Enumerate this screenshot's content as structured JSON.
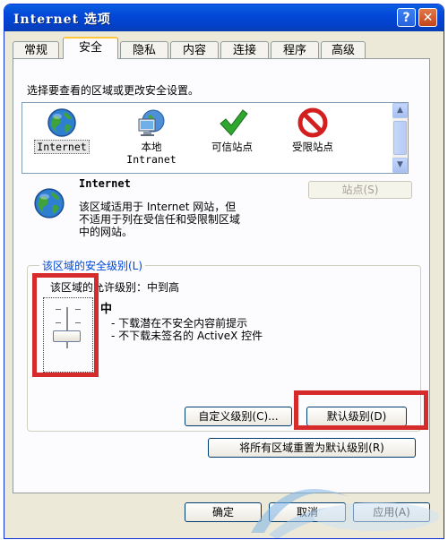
{
  "window": {
    "title": "Internet 选项",
    "help_button": "?",
    "close_button": "✕"
  },
  "tabs": [
    {
      "label": "常规",
      "active": false
    },
    {
      "label": "安全",
      "active": true
    },
    {
      "label": "隐私",
      "active": false
    },
    {
      "label": "内容",
      "active": false
    },
    {
      "label": "连接",
      "active": false
    },
    {
      "label": "程序",
      "active": false
    },
    {
      "label": "高级",
      "active": false
    }
  ],
  "security": {
    "prompt": "选择要查看的区域或更改安全设置。",
    "zones": [
      {
        "label": "Internet",
        "icon": "globe-icon",
        "selected": true
      },
      {
        "label": "本地",
        "label2": "Intranet",
        "icon": "computer-network-icon",
        "selected": false
      },
      {
        "label": "可信站点",
        "icon": "checkmark-icon",
        "selected": false
      },
      {
        "label": "受限站点",
        "icon": "no-entry-icon",
        "selected": false
      }
    ],
    "zone_info": {
      "title": "Internet",
      "desc_line1": "该区域适用于 Internet 网站，但",
      "desc_line2": "不适用于列在受信任和受限制区域",
      "desc_line3": "中的网站。"
    },
    "sites_button": "站点(S)",
    "group_title": "该区域的安全级别(L)",
    "allowed_level_text": "该区域的允许级别：中到高",
    "level": {
      "name": "中",
      "bullet1": "- 下载潜在不安全内容前提示",
      "bullet2": "- 不下载未签名的 ActiveX 控件"
    },
    "custom_level_button": "自定义级别(C)...",
    "default_level_button": "默认级别(D)",
    "reset_all_button": "将所有区域重置为默认级别(R)"
  },
  "footer": {
    "ok_button": "确定",
    "cancel_button": "取消",
    "apply_button": "应用(A)"
  },
  "colors": {
    "title_bar": "#0348d9",
    "highlight_box": "#d52b2b",
    "group_title": "#0046d5"
  }
}
